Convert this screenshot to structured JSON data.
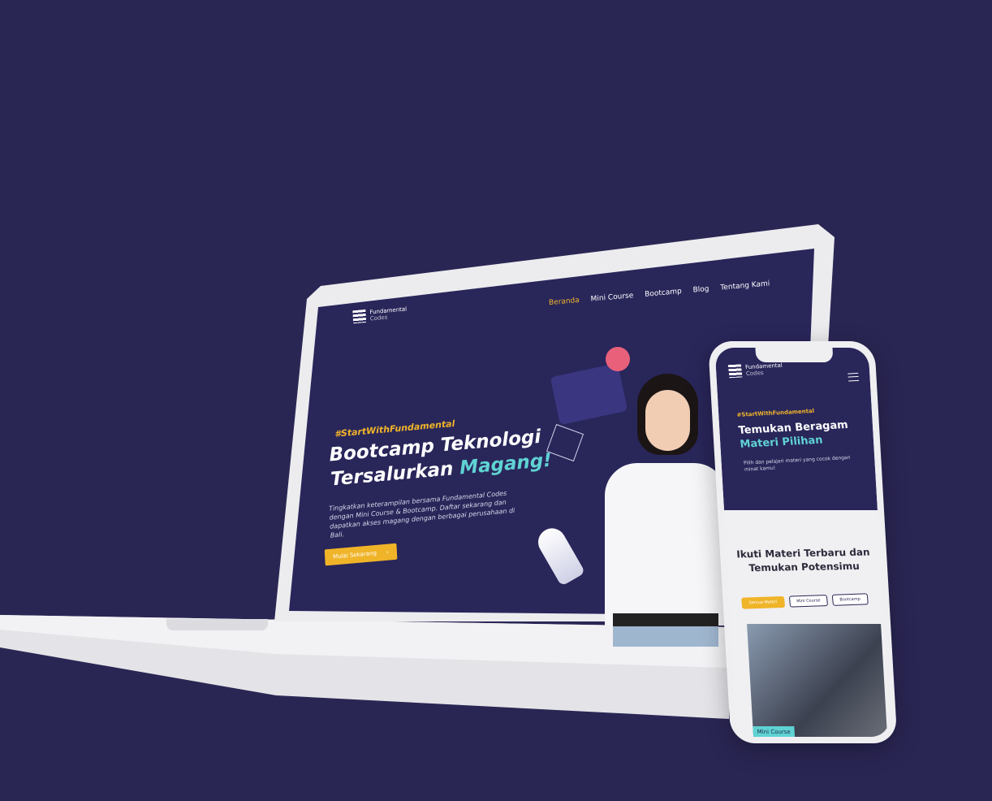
{
  "laptop": {
    "logo": {
      "line1": "Fundamental",
      "line2": "Codes"
    },
    "nav": [
      "Beranda",
      "Mini Course",
      "Bootcamp",
      "Blog",
      "Tentang Kami"
    ],
    "hero": {
      "tag": "#StartWithFundamental",
      "title_line1": "Bootcamp Teknologi",
      "title_line2_a": "Tersalurkan ",
      "title_line2_b": "Magang!",
      "description": "Tingkatkan keterampilan bersama Fundamental Codes dengan Mini Course & Bootcamp. Daftar sekarang dan dapatkan akses magang dengan berbagai perusahaan di Bali.",
      "cta": "Mulai Sekarang",
      "cta_icon": "chevron-right-icon"
    }
  },
  "phone": {
    "logo": {
      "line1": "Fundamental",
      "line2": "Codes"
    },
    "menu_icon": "hamburger-icon",
    "hero": {
      "tag": "#StartWithFundamental",
      "title_line1": "Temukan Beragam",
      "title_line2": "Materi Pilihan",
      "description": "Pilih dan pelajari materi yang cocok dengan minat kamu!"
    },
    "section": {
      "title_line1": "Ikuti Materi Terbaru dan",
      "title_line2": "Temukan Potensimu",
      "filters": [
        "Semua Materi",
        "Mini Course",
        "Bootcamp"
      ],
      "card_badge": "Mini Course"
    }
  },
  "colors": {
    "background": "#2a2654",
    "accent": "#f0b429",
    "highlight": "#5fd3d3"
  }
}
